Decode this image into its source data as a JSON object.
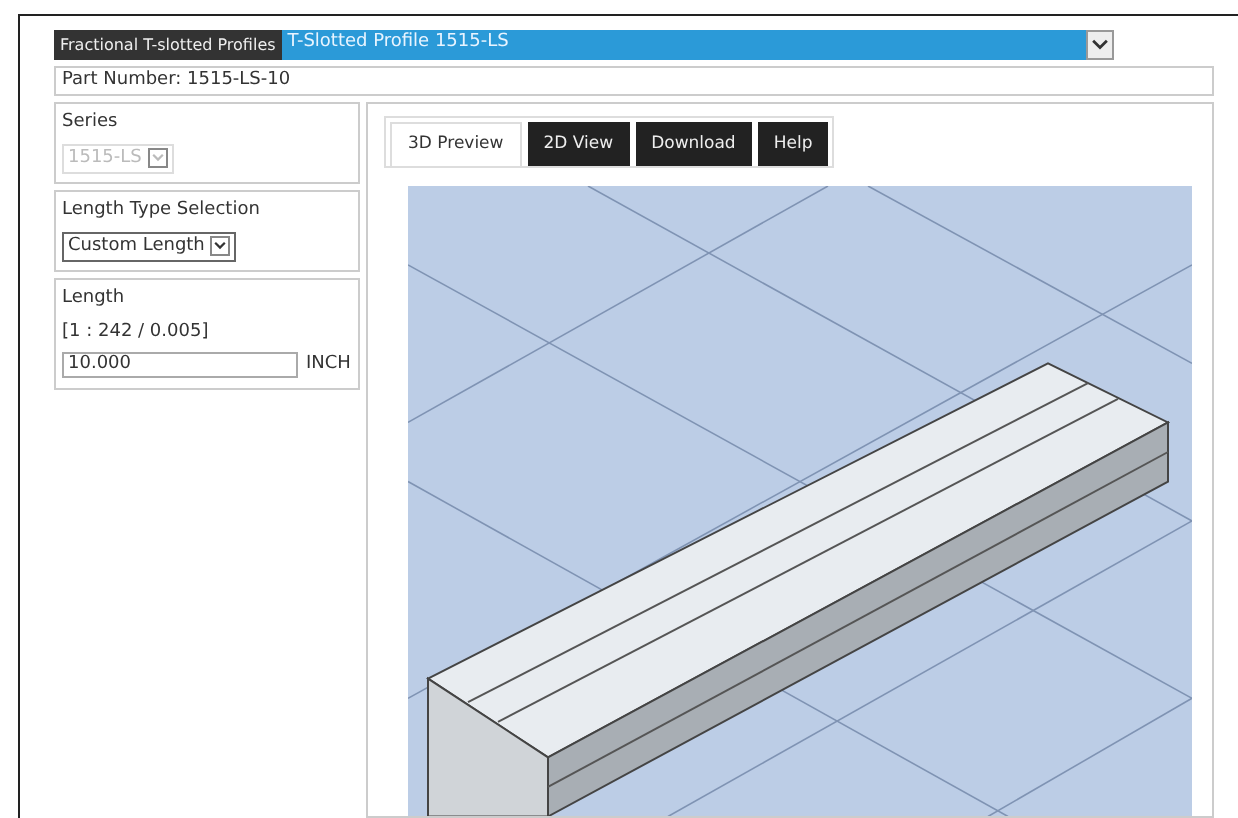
{
  "profile_bar": {
    "label": "Fractional T-slotted Profiles",
    "selected_profile": "T-Slotted Profile 1515-LS"
  },
  "part_number": "Part Number: 1515-LS-10",
  "series": {
    "label": "Series",
    "value": "1515-LS",
    "disabled": true
  },
  "length_type": {
    "label": "Length Type Selection",
    "value": "Custom Length"
  },
  "length": {
    "label": "Length",
    "range": "[1 : 242 / 0.005]",
    "value": "10.000",
    "unit": "INCH"
  },
  "tabs": [
    {
      "label": "3D Preview",
      "selected": true
    },
    {
      "label": "2D View",
      "selected": false
    },
    {
      "label": "Download",
      "selected": false
    },
    {
      "label": "Help",
      "selected": false
    }
  ]
}
